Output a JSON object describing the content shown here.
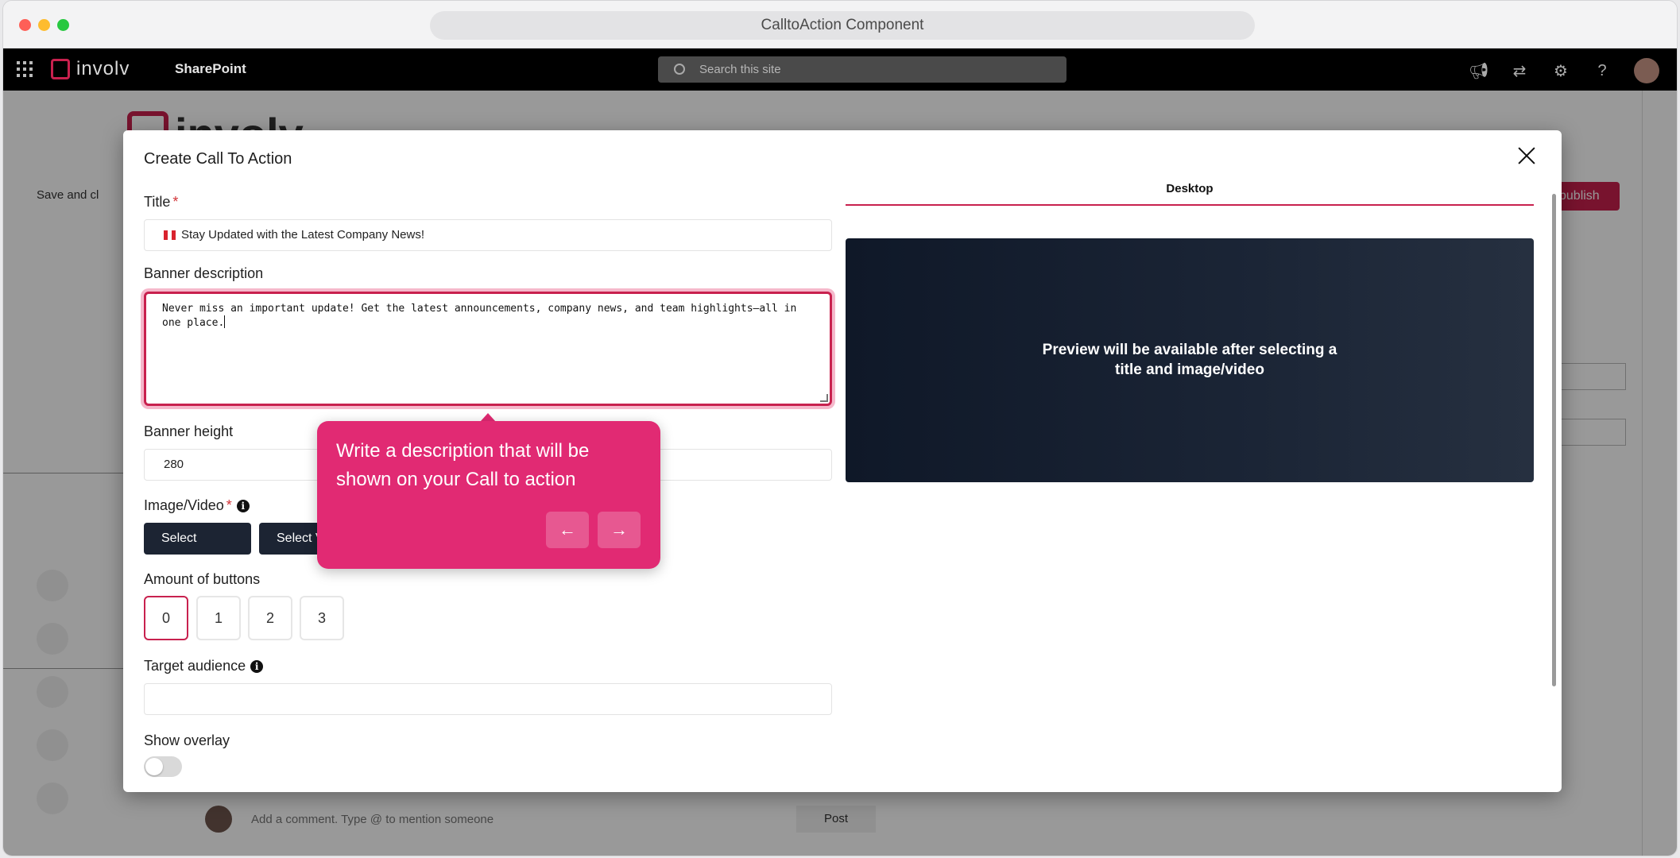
{
  "window": {
    "address_title": "CalltoAction Component"
  },
  "suitebar": {
    "logo_text": "involv",
    "app_name": "SharePoint",
    "search_placeholder": "Search this site",
    "icons": [
      "megaphone-icon",
      "share-icon",
      "gear-icon",
      "help-icon"
    ]
  },
  "background_page": {
    "logo_text": "involv",
    "save_label": "Save and cl",
    "publish_label": "publish",
    "comment_placeholder": "Add a comment. Type @ to mention someone",
    "post_label": "Post"
  },
  "modal": {
    "title": "Create Call To Action",
    "title_label": "Title",
    "title_required": "*",
    "title_value": "Stay Updated with the Latest Company News!",
    "banner_description_label": "Banner description",
    "banner_description_value": "Never miss an important update! Get the latest announcements, company news, and team highlights—all in one place.",
    "banner_height_label": "Banner height",
    "banner_height_value": "280",
    "image_video_label": "Image/Video",
    "image_video_required": "*",
    "select_image_label": "Select Image",
    "select_video_label": "Select V",
    "amount_label": "Amount of buttons",
    "amount_options": [
      "0",
      "1",
      "2",
      "3"
    ],
    "amount_selected": "0",
    "target_audience_label": "Target audience",
    "target_audience_value": "",
    "show_overlay_label": "Show overlay",
    "show_overlay_on": false,
    "tab_desktop": "Desktop",
    "preview_message_line1": "Preview will be available after selecting a",
    "preview_message_line2": "title and image/video"
  },
  "tooltip": {
    "text": "Write a description that will be shown on your Call to action",
    "prev_icon": "arrow-left-icon",
    "next_icon": "arrow-right-icon"
  },
  "colors": {
    "accent": "#c8214e",
    "tooltip_bg": "#e12a73",
    "dark_button": "#1c2433",
    "preview_bg": "#1b2536"
  }
}
